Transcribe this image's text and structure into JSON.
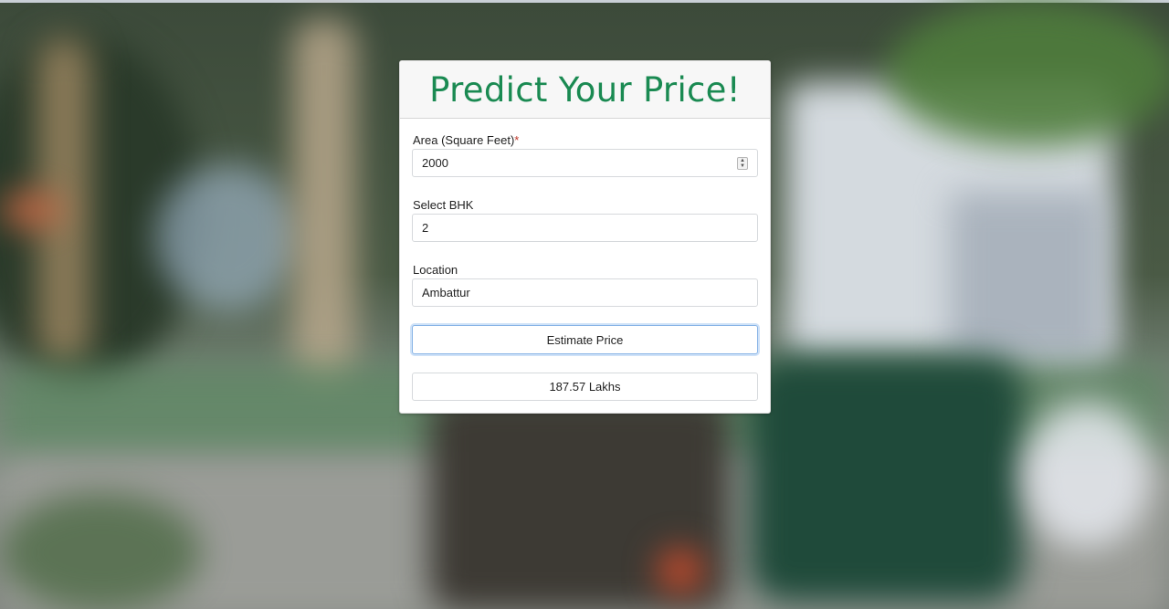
{
  "title": "Predict Your Price!",
  "form": {
    "area": {
      "label": "Area (Square Feet)",
      "required_mark": "*",
      "value": "2000"
    },
    "bhk": {
      "label": "Select BHK",
      "value": "2"
    },
    "location": {
      "label": "Location",
      "value": "Ambattur"
    },
    "submit_label": "Estimate Price",
    "result": "187.57 Lakhs"
  },
  "colors": {
    "title": "#1a8a52",
    "button_focus": "#88b4e6",
    "required": "#c0392b"
  },
  "icons": [
    "number-stepper-icon"
  ]
}
